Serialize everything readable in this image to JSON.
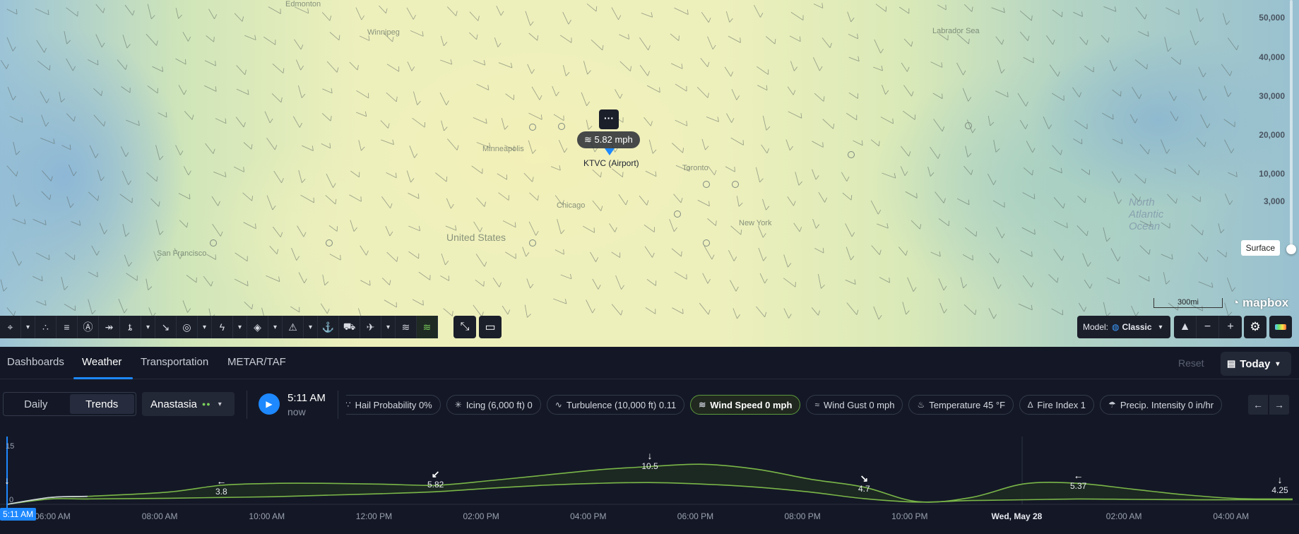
{
  "map": {
    "place_labels": [
      "Edmonton",
      "Winnipeg",
      "Minneapolis",
      "Toronto",
      "Chicago",
      "New York",
      "United States",
      "San Francisco",
      "Labrador Sea",
      "North Atlantic Ocean"
    ],
    "altitudes": [
      "50,000",
      "40,000",
      "30,000",
      "20,000",
      "10,000",
      "3,000"
    ],
    "surface_label": "Surface",
    "marker": {
      "menu_label": "···",
      "value": "5.82 mph",
      "name": "KTVC (Airport)"
    },
    "scale_label": "300mi",
    "attribution": "mapbox",
    "model_label": "Model:",
    "model_value": "Classic"
  },
  "tabs": [
    "Dashboards",
    "Weather",
    "Transportation",
    "METAR/TAF"
  ],
  "active_tab": "Weather",
  "reset_label": "Reset",
  "today_label": "Today",
  "view_toggle": {
    "daily": "Daily",
    "trends": "Trends"
  },
  "location_label": "Anastasia",
  "time": {
    "main": "5:11 AM",
    "sub": "now"
  },
  "chips": [
    {
      "label": "Hail Probability 0%",
      "icon": "hail-icon"
    },
    {
      "label": "Icing (6,000 ft) 0",
      "icon": "snowflake-icon"
    },
    {
      "label": "Turbulence (10,000 ft) 0.11",
      "icon": "turbulence-icon"
    },
    {
      "label": "Wind Speed 0 mph",
      "icon": "wind-icon",
      "active": true
    },
    {
      "label": "Wind Gust 0 mph",
      "icon": "gust-icon"
    },
    {
      "label": "Temperature 45 °F",
      "icon": "thermometer-icon"
    },
    {
      "label": "Fire Index 1",
      "icon": "flame-icon"
    },
    {
      "label": "Precip. Intensity 0 in/hr",
      "icon": "rain-icon"
    }
  ],
  "chart_data": {
    "type": "area",
    "title": "",
    "ylabel": "",
    "y_ticks": [
      "15",
      "0"
    ],
    "ylim": [
      0,
      15
    ],
    "x_labels": [
      "06:00 AM",
      "08:00 AM",
      "10:00 AM",
      "12:00 PM",
      "02:00 PM",
      "04:00 PM",
      "06:00 PM",
      "08:00 PM",
      "10:00 PM",
      "Wed, May 28",
      "02:00 AM",
      "04:00 AM"
    ],
    "now_label": "5:11 AM",
    "series": [
      {
        "hours": [
          0,
          0.8,
          1.5,
          3,
          4,
          5,
          6,
          7,
          8,
          9,
          10,
          11,
          12,
          13,
          14,
          15,
          16,
          17,
          18,
          19,
          20,
          21,
          22,
          23,
          24
        ],
        "values": [
          0,
          1.8,
          2.1,
          3.2,
          5.0,
          5.5,
          5.5,
          5.3,
          5.0,
          6.2,
          7.6,
          9.0,
          9.9,
          10.5,
          9.2,
          6.6,
          4.5,
          0.7,
          1.8,
          5.4,
          5.5,
          4.0,
          2.5,
          1.5,
          1.4
        ]
      },
      {
        "hours": [
          0,
          0.8,
          1.5,
          3,
          4,
          5,
          6,
          7,
          8,
          9,
          10,
          11,
          12,
          13,
          14,
          15,
          16,
          17,
          18,
          19,
          20,
          21,
          22,
          23,
          24
        ],
        "values": [
          0,
          1.4,
          1.4,
          1.6,
          1.8,
          2.0,
          2.4,
          2.8,
          3.3,
          4.2,
          5.0,
          5.5,
          5.7,
          5.3,
          4.5,
          3.2,
          1.5,
          0.6,
          1.0,
          1.2,
          1.4,
          1.3,
          1.2,
          1.2,
          1.2
        ]
      }
    ],
    "annotations": [
      {
        "hour": 0,
        "value": "",
        "arrow": "↓"
      },
      {
        "hour": 4,
        "value": "3.8",
        "arrow": "←"
      },
      {
        "hour": 8,
        "value": "5.82",
        "arrow": "↙"
      },
      {
        "hour": 12,
        "value": "10.5",
        "arrow": "↓"
      },
      {
        "hour": 16,
        "value": "4.7",
        "arrow": "↘"
      },
      {
        "hour": 20,
        "value": "5.37",
        "arrow": "←"
      },
      {
        "hour": 24,
        "value": "4.25",
        "arrow": "↓"
      }
    ],
    "colors": {
      "top_line": "#7ab648",
      "fill": "#1d2a22",
      "now_line": "#1e88ff",
      "early_line": "#cfd3dc"
    }
  }
}
